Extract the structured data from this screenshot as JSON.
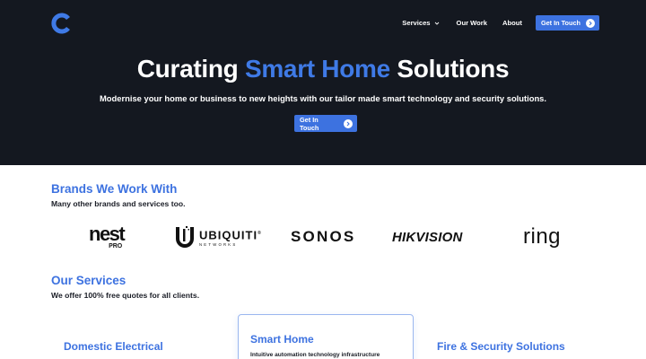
{
  "header": {
    "logo_icon": "c-logo-icon",
    "nav": {
      "services_label": "Services",
      "our_work_label": "Our Work",
      "about_label": "About",
      "cta_label": "Get In Touch"
    }
  },
  "hero": {
    "title_before": "Curating ",
    "title_accent": "Smart Home",
    "title_after": " Solutions",
    "subtitle": "Modernise your home or business to new heights with our tailor made smart technology and security solutions.",
    "cta_label": "Get In Touch"
  },
  "brands": {
    "title": "Brands We Work With",
    "subtitle": "Many other brands and services too.",
    "logos": {
      "nest": "nest",
      "nest_pro": "PRO",
      "ubiquiti": "UBIQUITI",
      "ubiquiti_mark": "®",
      "ubiquiti_sub": "NETWORKS",
      "sonos": "SONOS",
      "hikvision": "HIKVISION",
      "ring": "ring"
    }
  },
  "services": {
    "title": "Our Services",
    "subtitle": "We offer 100% free quotes for all clients.",
    "cards": [
      {
        "title": "Domestic Electrical"
      },
      {
        "title": "Smart Home",
        "description": "Intuitive automation technology infrastructure"
      },
      {
        "title": "Fire & Security Solutions"
      }
    ]
  },
  "colors": {
    "accent": "#3d72e0",
    "hero_background": "#141820",
    "page_background": "#ffffff",
    "text": "#1a1d26"
  }
}
